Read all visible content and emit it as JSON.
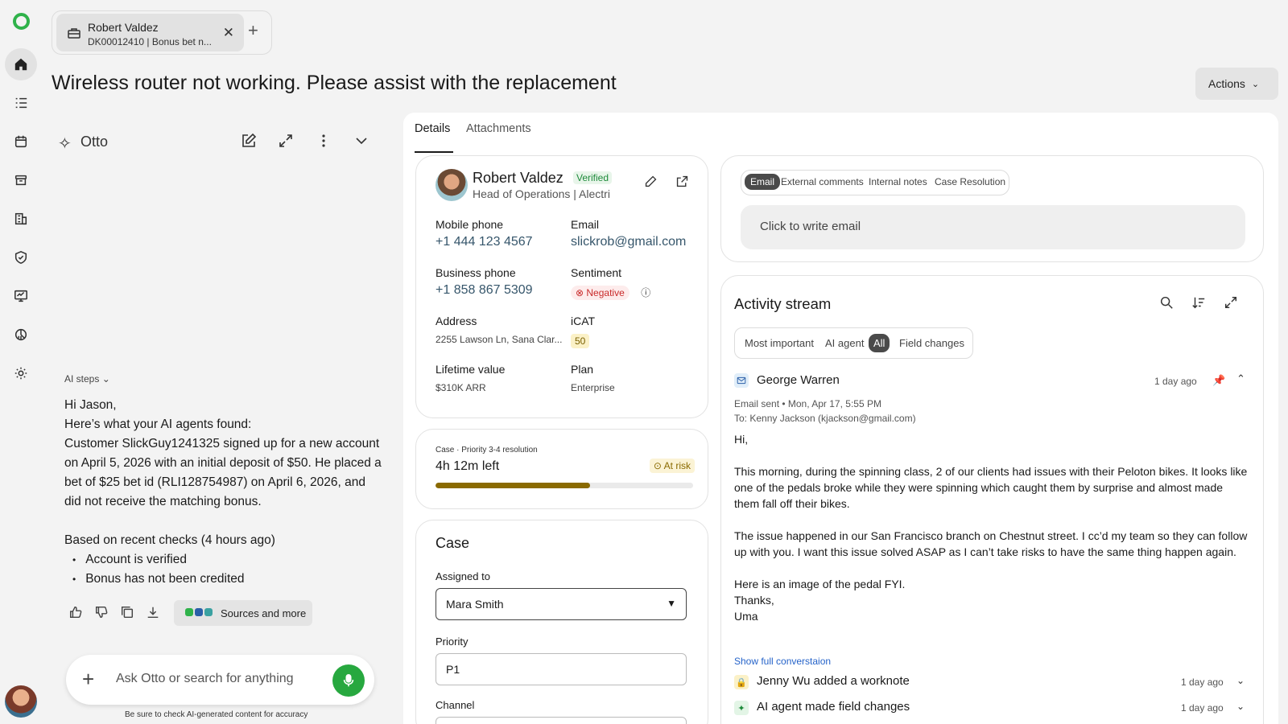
{
  "tab": {
    "title": "Robert Valdez",
    "subtitle": "DK00012410 | Bonus bet n..."
  },
  "page_title": "Wireless router not working. Please assist with the replacement",
  "actions_label": "Actions",
  "nav_icons": [
    "home-icon",
    "tasks-icon",
    "calendar-icon",
    "inbox-icon",
    "buildings-icon",
    "shield-icon",
    "monitor-icon",
    "analytics-icon",
    "settings-icon"
  ],
  "otto": {
    "name": "Otto",
    "ai_steps_label": "AI steps",
    "greeting": "Hi Jason,",
    "intro": "Here’s what your AI agents found:",
    "finding": "Customer SlickGuy1241325 signed up for a new account on April 5, 2026 with an initial deposit of $50. He placed a bet of $25 bet id (RLI128754987) on April 6, 2026, and did not receive the matching bonus.",
    "checks_heading": "Based on recent checks (4 hours ago)",
    "checks": [
      "Account is verified",
      "Bonus has not been credited"
    ],
    "sources_label": "Sources and more",
    "ask_placeholder": "Ask Otto or search for anything",
    "disclaimer": "Be sure to check AI-generated content for accuracy"
  },
  "main_tabs": [
    "Details",
    "Attachments"
  ],
  "contact": {
    "name": "Robert Valdez",
    "verified": "Verified",
    "role": "Head of Operations | Alectri",
    "mobile_label": "Mobile phone",
    "mobile": "+1 444 123 4567",
    "email_label": "Email",
    "email": "slickrob@gmail.com",
    "business_label": "Business phone",
    "business": "+1 858 867 5309",
    "sentiment_label": "Sentiment",
    "sentiment": "Negative",
    "address_label": "Address",
    "address": "2255 Lawson Ln, Sana Clar...",
    "icat_label": "iCAT",
    "icat": "50",
    "ltv_label": "Lifetime value",
    "ltv": "$310K ARR",
    "plan_label": "Plan",
    "plan": "Enterprise"
  },
  "sla": {
    "caption": "Case · Priority 3-4 resolution",
    "time_left": "4h 12m left",
    "status": "At risk",
    "progress": 0.6,
    "color": "#8a6a00"
  },
  "case": {
    "title": "Case",
    "assigned_label": "Assigned to",
    "assigned": "Mara Smith",
    "priority_label": "Priority",
    "priority": "P1",
    "channel_label": "Channel"
  },
  "composer": {
    "tabs": [
      "Email",
      "External comments",
      "Internal notes",
      "Case Resolution"
    ],
    "write_placeholder": "Click to write email"
  },
  "activity": {
    "title": "Activity stream",
    "filters": [
      "Most important",
      "AI agent",
      "All",
      "Field changes"
    ],
    "entry": {
      "author": "George Warren",
      "time": "1 day ago",
      "meta": "Email sent • Mon, Apr 17, 5:55 PM",
      "to": "To: Kenny Jackson (kjackson@gmail.com)",
      "greeting": "Hi,",
      "para1": "This morning, during the spinning class, 2 of our clients had issues with their Peloton bikes. It looks like one of the pedals broke while they were spinning which caught them by surprise and almost made them fall off their bikes.",
      "para2": "The issue happened in our San Francisco branch on Chestnut street. I cc’d my team so they can follow up with you. I want this issue solved ASAP as I can’t take risks to have the same thing happen again.",
      "para3": "Here is an image of the pedal FYI.",
      "signoff": "Thanks,",
      "signature": "Uma",
      "show_full": "Show full converstaion"
    },
    "items": [
      {
        "text": "Jenny Wu added a worknote",
        "time": "1 day ago"
      },
      {
        "text": "AI agent made field changes",
        "time": "1 day ago"
      }
    ]
  }
}
